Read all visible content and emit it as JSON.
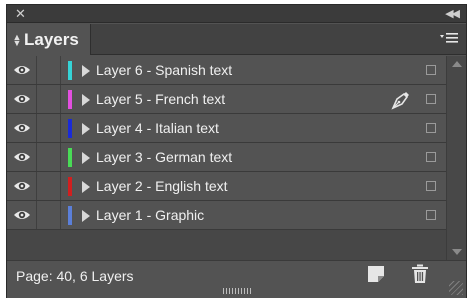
{
  "window": {
    "close_icon": "close-icon",
    "collapse_icon": "collapse-panel-icon"
  },
  "panel": {
    "tab_label": "Layers",
    "menu_icon": "panel-menu-icon"
  },
  "layers": [
    {
      "name": "Layer 6 - Spanish text",
      "color": "#35d3d6",
      "visible": true,
      "has_pen": false
    },
    {
      "name": "Layer 5 - French text",
      "color": "#e34fe0",
      "visible": true,
      "has_pen": true
    },
    {
      "name": "Layer 4 - Italian text",
      "color": "#1a2bd8",
      "visible": true,
      "has_pen": false
    },
    {
      "name": "Layer 3 - German text",
      "color": "#49db56",
      "visible": true,
      "has_pen": false
    },
    {
      "name": "Layer 2 - English text",
      "color": "#d21f1f",
      "visible": true,
      "has_pen": false
    },
    {
      "name": "Layer 1 - Graphic",
      "color": "#5b7fd9",
      "visible": true,
      "has_pen": false
    }
  ],
  "footer": {
    "status": "Page: 40, 6 Layers"
  },
  "colors": {
    "panel_bg": "#535353",
    "row_bg": "#535353",
    "text": "#f0f0f0"
  }
}
